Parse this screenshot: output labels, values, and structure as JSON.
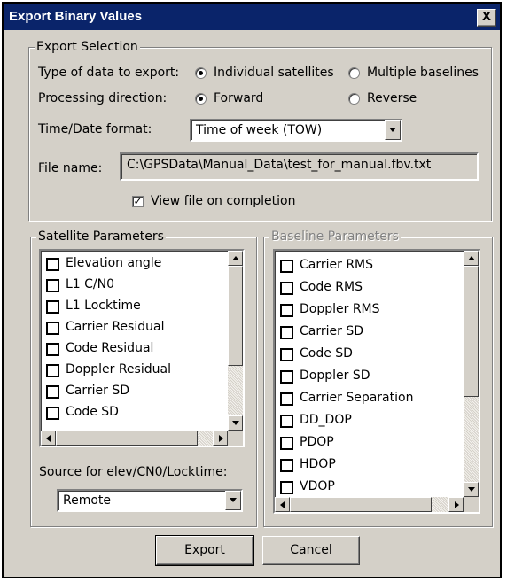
{
  "window": {
    "title": "Export Binary Values",
    "close_label": "X"
  },
  "export_selection": {
    "legend": "Export Selection",
    "type_label": "Type of data to export:",
    "type_options": [
      "Individual satellites",
      "Multiple baselines"
    ],
    "type_selected": "Individual satellites",
    "direction_label": "Processing direction:",
    "direction_options": [
      "Forward",
      "Reverse"
    ],
    "direction_selected": "Forward",
    "time_label": "Time/Date format:",
    "time_value": "Time of week (TOW)",
    "file_label": "File name:",
    "file_value": "C:\\GPSData\\Manual_Data\\test_for_manual.fbv.txt",
    "view_label": "View file on completion",
    "view_checked": true
  },
  "satellite_parameters": {
    "legend": "Satellite Parameters",
    "items": [
      "Elevation angle",
      "L1 C/N0",
      "L1 Locktime",
      "Carrier Residual",
      "Code Residual",
      "Doppler Residual",
      "Carrier SD",
      "Code SD"
    ],
    "source_label": "Source for elev/CN0/Locktime:",
    "source_value": "Remote"
  },
  "baseline_parameters": {
    "legend": "Baseline Parameters",
    "items": [
      "Carrier RMS",
      "Code RMS",
      "Doppler RMS",
      "Carrier SD",
      "Code SD",
      "Doppler SD",
      "Carrier Separation",
      "DD_DOP",
      "PDOP",
      "HDOP",
      "VDOP"
    ]
  },
  "buttons": {
    "export": "Export",
    "cancel": "Cancel"
  },
  "colors": {
    "titlebar": "#0a246a",
    "dialog": "#d4d0c8"
  }
}
